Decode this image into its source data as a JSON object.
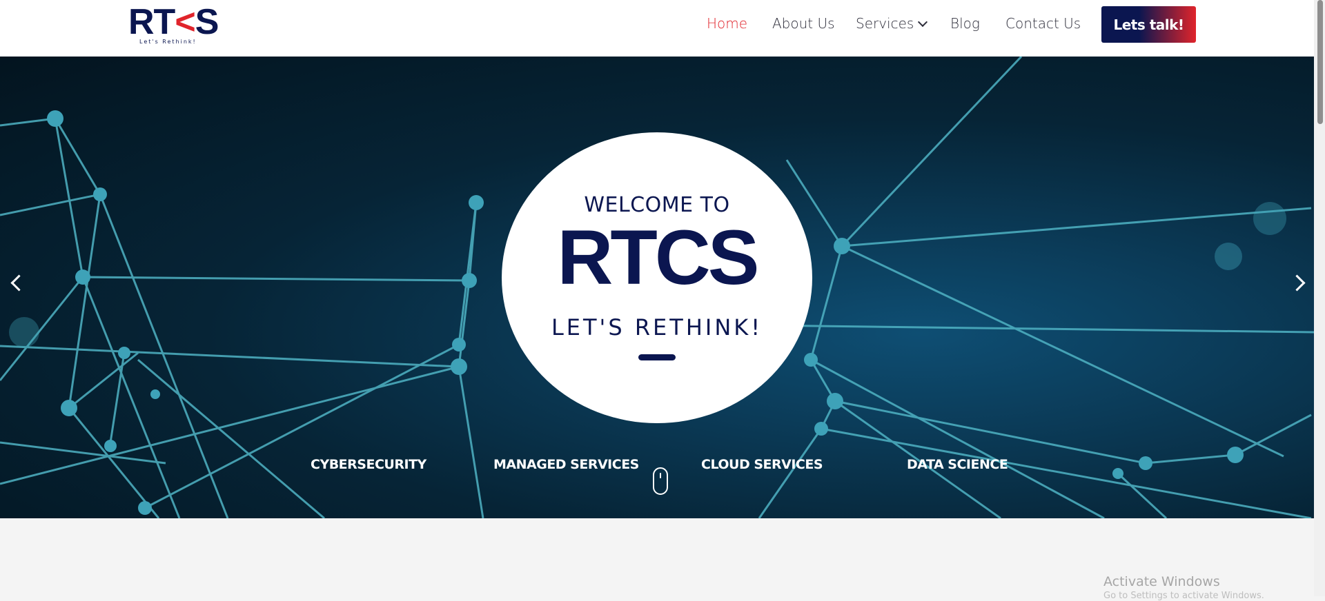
{
  "header": {
    "logo": {
      "text_left": "RT",
      "text_chevron": "<",
      "text_right": "S",
      "tagline": "Let's Rethink!"
    },
    "nav": [
      {
        "label": "Home",
        "active": true
      },
      {
        "label": "About Us"
      },
      {
        "label": "Services",
        "has_dropdown": true
      },
      {
        "label": "Blog"
      },
      {
        "label": "Contact Us"
      }
    ],
    "cta_label": "Lets talk!"
  },
  "hero": {
    "welcome": "WELCOME TO",
    "brand": "RTCS",
    "slogan": "LET'S RETHINK!",
    "services": [
      "CYBERSECURITY",
      "MANAGED SERVICES",
      "CLOUD SERVICES",
      "DATA SCIENCE"
    ],
    "prev_icon": "chevron-left-icon",
    "next_icon": "chevron-right-icon",
    "scroll_icon": "mouse-scroll-icon"
  },
  "watermark": {
    "title": "Activate Windows",
    "subtitle": "Go to Settings to activate Windows."
  },
  "colors": {
    "navy": "#0b1650",
    "red": "#e0242b",
    "hero_dark": "#03141f",
    "hero_mid": "#0e4e73",
    "network": "#4fb3c4"
  }
}
